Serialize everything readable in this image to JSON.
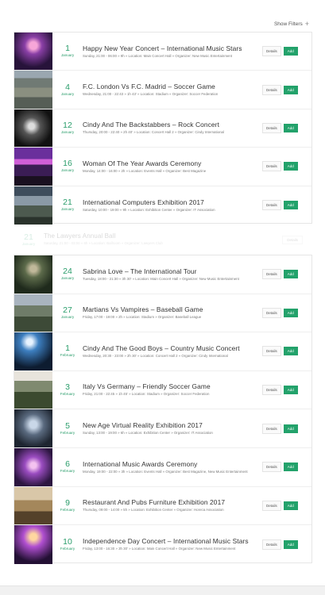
{
  "toolbar": {
    "show_filters_label": "Show Filters",
    "plus_icon": "+"
  },
  "buttons": {
    "details": "Details",
    "add": "Add"
  },
  "events_group_1": [
    {
      "day": "1",
      "month": "January",
      "title": "Happy New Year Concert – International Music Stars",
      "meta": "Sunday, 21:00 - 06:00 » 9h » Location: Main Concert Hall » Organizer: New Music Entertainment",
      "image": "t-stage"
    },
    {
      "day": "4",
      "month": "January",
      "title": "F.C. London Vs F.C. Madrid – Soccer Game",
      "meta": "Wednesday, 21:00 - 22:43 » 1h 43' » Location: Stadium » Organizer: Soccer Federation",
      "image": "t-stadium"
    },
    {
      "day": "12",
      "month": "January",
      "title": "Cindy And The Backstabbers – Rock Concert",
      "meta": "Thursday, 20:00 - 22:40 » 2h 40' » Location: Concert Hall 2 » Organizer: Cindy International",
      "image": "t-bw"
    },
    {
      "day": "16",
      "month": "January",
      "title": "Woman Of The Year Awards Ceremony",
      "meta": "Monday, 14:00 - 16:00 » 2h » Location: Events Hall » Organizer: Best Magazine",
      "image": "t-awards"
    },
    {
      "day": "21",
      "month": "January",
      "title": "International Computers Exhibition 2017",
      "meta": "Saturday, 10:00 - 19:00 » 9h » Location: Exhibition Center » Organizer: IT Association",
      "image": "t-expo"
    }
  ],
  "faded_event": {
    "day": "21",
    "month": "January",
    "title": "The Lawyers Annual Ball",
    "meta": "Saturday, 21:00 - 03:00 » 6h » Location: Ballroom » Organizer: Lawyers Club",
    "button": "Details"
  },
  "events_group_2": [
    {
      "day": "24",
      "month": "January",
      "title": "Sabrina Love – The International Tour",
      "meta": "Tuesday, 18:00 - 21:30 » 3h 30' » Location: Main Concert Hall » Organizer: New Music Entertainment",
      "image": "t-singer"
    },
    {
      "day": "27",
      "month": "January",
      "title": "Martians Vs Vampires – Baseball Game",
      "meta": "Friday, 17:00 - 19:00 » 2h » Location: Stadium » Organizer: Baseball League",
      "image": "t-ball"
    },
    {
      "day": "1",
      "month": "February",
      "title": "Cindy And The Good Boys – Country Music Concert",
      "meta": "Wednesday, 20:30 - 23:00 » 2h 30' » Location: Concert Hall 2 » Organizer: Cindy International",
      "image": "t-crowd"
    },
    {
      "day": "3",
      "month": "February",
      "title": "Italy Vs Germany – Friendly Soccer Game",
      "meta": "Friday, 21:00 - 22:45 » 1h 45' » Location: Stadium » Organizer: Soccer Federation",
      "image": "t-soccer"
    },
    {
      "day": "5",
      "month": "February",
      "title": "New Age Virtual Reality Exhibition 2017",
      "meta": "Sunday, 13:00 - 19:00 » 6h » Location: Exhibition Center » Organizer: IT Association",
      "image": "t-vr"
    },
    {
      "day": "6",
      "month": "February",
      "title": "International Music Awards Ceremony",
      "meta": "Monday, 19:00 - 22:00 » 3h » Location: Events Hall » Organizer: Best Magazine, New Music Entertainment",
      "image": "t-music"
    },
    {
      "day": "9",
      "month": "February",
      "title": "Restaurant And Pubs Furniture Exhibition 2017",
      "meta": "Thursday, 09:00 - 14:00 » 5h » Location: Exhibition Center » Organizer: Horeca Association",
      "image": "t-furniture"
    },
    {
      "day": "10",
      "month": "February",
      "title": "Independence Day Concert – International Music Stars",
      "meta": "Friday, 13:00 - 16:30 » 3h 30' » Location: Main Concert Hall » Organizer: New Music Entertainment",
      "image": "t-indep"
    }
  ]
}
